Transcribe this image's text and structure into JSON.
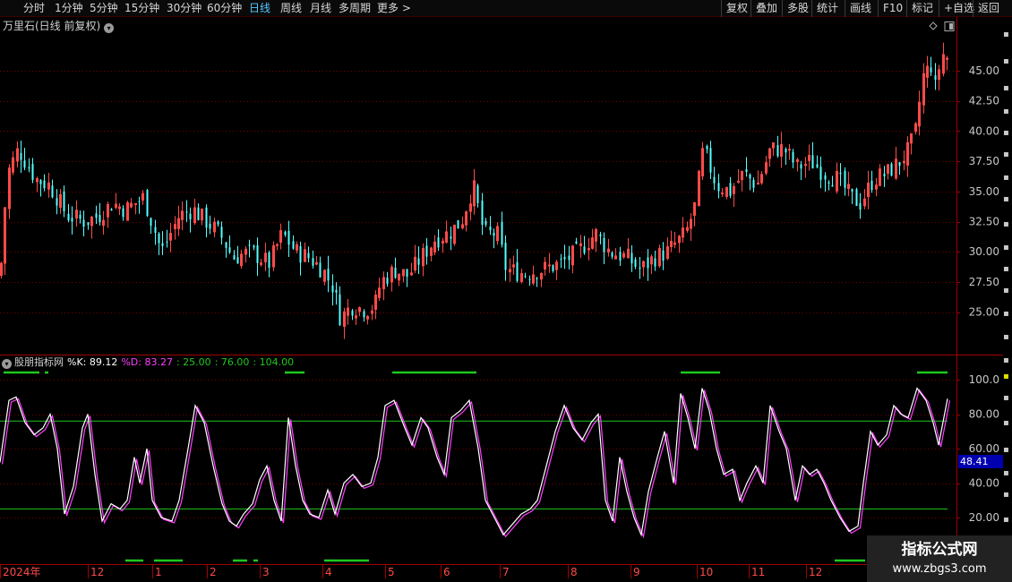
{
  "toolbar": {
    "periods": [
      "分时",
      "1分钟",
      "5分钟",
      "15分钟",
      "30分钟",
      "60分钟",
      "日线",
      "周线",
      "月线",
      "多周期",
      "更多 >"
    ],
    "active_period": "日线",
    "right_buttons": [
      "复权",
      "叠加",
      "多股",
      "统计",
      "画线",
      "F10",
      "标记",
      "+自选",
      "返回"
    ]
  },
  "main_chart": {
    "title": "万里石(日线 前复权)",
    "price_axis": [
      "45.00",
      "42.50",
      "40.00",
      "37.50",
      "35.00",
      "32.50",
      "30.00",
      "27.50",
      "25.00"
    ],
    "price_range": [
      22.3,
      48.2
    ],
    "up_color": "#ff4a4a",
    "down_color": "#54ffff"
  },
  "indicator": {
    "name": "股朋指标网",
    "k_label": "%K: 89.12",
    "d_label": "%D: 83.27",
    "level_1": ": 25.00",
    "level_2": ": 76.00",
    "level_3": ": 104.00",
    "axis": [
      "100.0",
      "80.00",
      "60.00",
      "40.00",
      "20.00"
    ],
    "cursor_value": "48.41",
    "k_color": "#ffffff",
    "d_color": "#ff40ff",
    "level_color": "#1ec81e"
  },
  "date_axis": [
    "2024年",
    "12",
    "1",
    "2",
    "3",
    "4",
    "5",
    "6",
    "7",
    "8",
    "9",
    "10",
    "11",
    "12"
  ],
  "watermark": {
    "title": "指标公式网",
    "url": "www.zbgs3.com"
  },
  "chart_data": {
    "type": "candlestick",
    "title": "万里石(日线 前复权)",
    "y_ticks": [
      25.0,
      27.5,
      30.0,
      32.5,
      35.0,
      37.5,
      40.0,
      42.5,
      45.0
    ],
    "ylim": [
      22.3,
      48.2
    ],
    "x_tick_labels": [
      "2024年",
      "12",
      "1",
      "2",
      "3",
      "4",
      "5",
      "6",
      "7",
      "8",
      "9",
      "10",
      "11",
      "12"
    ],
    "close_keypoints": [
      [
        0,
        28.0
      ],
      [
        8,
        36.5
      ],
      [
        20,
        38.5
      ],
      [
        40,
        36.0
      ],
      [
        55,
        35.5
      ],
      [
        75,
        33.0
      ],
      [
        95,
        32.5
      ],
      [
        110,
        33.0
      ],
      [
        125,
        34.0
      ],
      [
        140,
        33.5
      ],
      [
        160,
        34.5
      ],
      [
        180,
        30.0
      ],
      [
        200,
        33.0
      ],
      [
        215,
        33.5
      ],
      [
        230,
        32.5
      ],
      [
        245,
        31.5
      ],
      [
        260,
        29.5
      ],
      [
        280,
        30.0
      ],
      [
        300,
        29.0
      ],
      [
        315,
        31.5
      ],
      [
        330,
        30.0
      ],
      [
        345,
        29.5
      ],
      [
        360,
        28.5
      ],
      [
        372,
        27.0
      ],
      [
        380,
        24.5
      ],
      [
        392,
        25.5
      ],
      [
        408,
        25.2
      ],
      [
        418,
        25.5
      ],
      [
        425,
        27.5
      ],
      [
        440,
        28.5
      ],
      [
        455,
        28.0
      ],
      [
        470,
        29.5
      ],
      [
        485,
        31.0
      ],
      [
        500,
        31.5
      ],
      [
        515,
        32.5
      ],
      [
        528,
        35.5
      ],
      [
        540,
        31.5
      ],
      [
        555,
        31.5
      ],
      [
        565,
        28.5
      ],
      [
        585,
        28.2
      ],
      [
        605,
        28.5
      ],
      [
        625,
        29.0
      ],
      [
        645,
        30.0
      ],
      [
        665,
        31.5
      ],
      [
        680,
        30.0
      ],
      [
        700,
        29.5
      ],
      [
        715,
        28.5
      ],
      [
        730,
        29.5
      ],
      [
        745,
        30.0
      ],
      [
        765,
        31.5
      ],
      [
        775,
        33.5
      ],
      [
        785,
        38.5
      ],
      [
        800,
        35.5
      ],
      [
        815,
        35.0
      ],
      [
        830,
        36.5
      ],
      [
        845,
        35.5
      ],
      [
        860,
        38.5
      ],
      [
        875,
        38.5
      ],
      [
        890,
        37.0
      ],
      [
        905,
        37.5
      ],
      [
        920,
        36.5
      ],
      [
        935,
        36.0
      ],
      [
        950,
        34.5
      ],
      [
        960,
        34.0
      ],
      [
        975,
        36.0
      ],
      [
        990,
        36.5
      ],
      [
        1005,
        37.5
      ],
      [
        1015,
        38.5
      ],
      [
        1022,
        40.0
      ],
      [
        1030,
        44.5
      ],
      [
        1040,
        45.5
      ],
      [
        1045,
        43.0
      ],
      [
        1050,
        46.5
      ],
      [
        1058,
        46.0
      ]
    ]
  }
}
